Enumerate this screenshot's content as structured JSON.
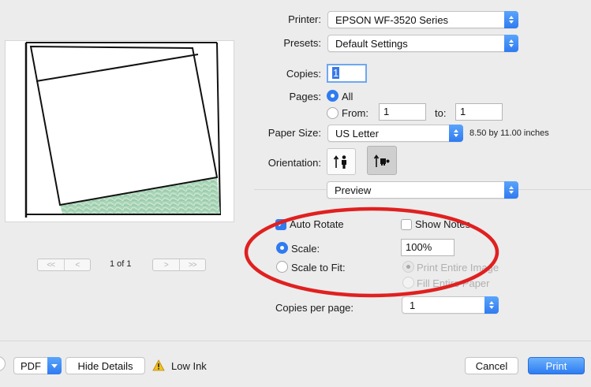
{
  "preview": {
    "page_count": "1 of 1",
    "nav_first": "<<",
    "nav_prev": "<",
    "nav_next": ">",
    "nav_last": ">>"
  },
  "printer": {
    "label": "Printer:",
    "value": "EPSON WF-3520 Series"
  },
  "presets": {
    "label": "Presets:",
    "value": "Default Settings"
  },
  "copies": {
    "label": "Copies:",
    "value": "1"
  },
  "pages": {
    "label": "Pages:",
    "all_label": "All",
    "from_label": "From:",
    "from_value": "1",
    "to_label": "to:",
    "to_value": "1",
    "selected": "All"
  },
  "paper_size": {
    "label": "Paper Size:",
    "value": "US Letter",
    "dimensions": "8.50 by 11.00 inches"
  },
  "orientation": {
    "label": "Orientation:",
    "selected": "landscape"
  },
  "section": {
    "value": "Preview"
  },
  "options": {
    "auto_rotate": {
      "label": "Auto Rotate",
      "checked": true
    },
    "show_notes": {
      "label": "Show Notes",
      "checked": false
    },
    "scale": {
      "label": "Scale:",
      "value": "100%",
      "selected": true
    },
    "scale_to_fit": {
      "label": "Scale to Fit:",
      "selected": false
    },
    "print_entire_image": {
      "label": "Print Entire Image"
    },
    "fill_entire_paper": {
      "label": "Fill Entire Paper"
    }
  },
  "copies_per_page": {
    "label": "Copies per page:",
    "value": "1"
  },
  "footer": {
    "pdf_label": "PDF",
    "hide_details_label": "Hide Details",
    "low_ink_label": "Low Ink",
    "cancel_label": "Cancel",
    "print_label": "Print"
  },
  "colors": {
    "accent": "#2f7bf0",
    "annotation": "#e02020",
    "preview_green": "#9fcfb0"
  }
}
